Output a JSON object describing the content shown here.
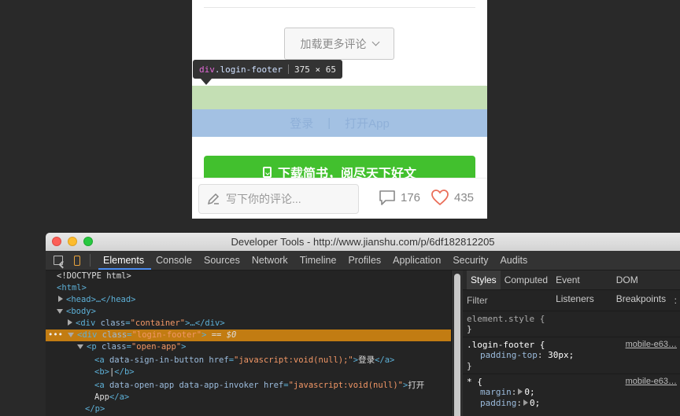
{
  "phone": {
    "load_more_label": "加载更多评论",
    "footer_login": "登录",
    "footer_sep": "|",
    "footer_open_app": "打开App",
    "download_label": "下载简书，阅尽天下好文",
    "comment_placeholder": "写下你的评论...",
    "comment_count": "176",
    "like_count": "435"
  },
  "tooltip": {
    "tag": "div",
    "class_name": ".login-footer",
    "dimensions": "375 × 65"
  },
  "devtools": {
    "window_title": "Developer Tools - http://www.jianshu.com/p/6df182812205",
    "tabs": [
      "Elements",
      "Console",
      "Sources",
      "Network",
      "Timeline",
      "Profiles",
      "Application",
      "Security",
      "Audits"
    ],
    "active_tab": "Elements",
    "dom": {
      "doctype": "<!DOCTYPE html>",
      "html_open": "<html>",
      "head": "<head>…</head>",
      "body_open": "<body>",
      "container_tag": "<div",
      "container_attr": "class",
      "container_val": "\"container\"",
      "container_rest": ">…</div>",
      "login_tag": "<div",
      "login_attr": "class",
      "login_val": "\"login-footer\"",
      "login_close": ">",
      "login_eq": "== $0",
      "p_tag": "<p",
      "p_attr": "class",
      "p_val": "\"open-app\"",
      "p_close": ">",
      "a1_tag": "<a",
      "a1_attr": "data-sign-in-button href",
      "a1_val": "\"javascript:void(null);\"",
      "a1_text": "登录",
      "a1_close": "</a>",
      "b_open": "<b>",
      "b_text": "|",
      "b_close": "</b>",
      "a2_tag": "<a",
      "a2_attr": "data-open-app data-app-invoker href",
      "a2_val": "\"javascript:void(null)\"",
      "a2_text1": "打开",
      "a2_text2": "App",
      "a2_close": "</a>",
      "p_end": "</p>"
    },
    "styles": {
      "tabs": [
        "Styles",
        "Computed",
        "Event Listeners",
        "DOM Breakpoints"
      ],
      "active_tab": "Styles",
      "filter_label": "Filter",
      "filter_suffix": ":",
      "element_style": "element.style {",
      "close_brace": "}",
      "rule1_selector": ".login-footer {",
      "rule1_source": "mobile-e63…",
      "rule1_prop": "padding-top",
      "rule1_value": "30px;",
      "rule2_selector": "* {",
      "rule2_source": "mobile-e63…",
      "rule2_prop1": "margin",
      "rule2_value1": "0;",
      "rule2_prop2": "padding",
      "rule2_value2": "0;"
    }
  }
}
